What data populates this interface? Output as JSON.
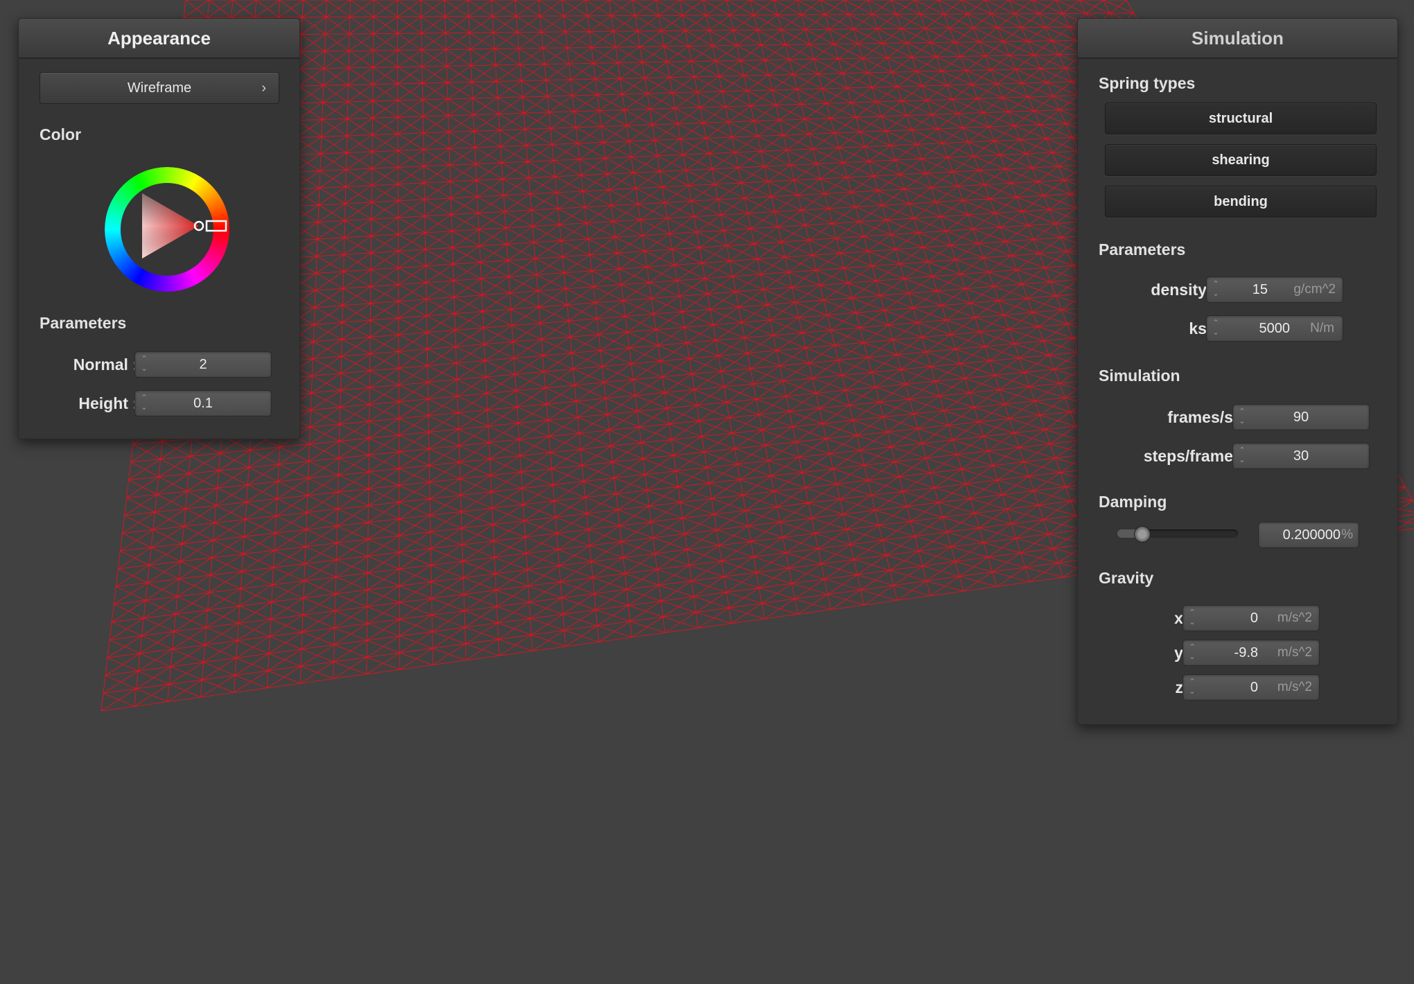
{
  "appearance": {
    "title": "Appearance",
    "shader_popup": {
      "label": "Wireframe",
      "chevron": "›"
    },
    "color": {
      "label": "Color",
      "value": "#d82020"
    },
    "parameters_label": "Parameters",
    "normal": {
      "label": "Normal :",
      "value": "2"
    },
    "height": {
      "label": "Height :",
      "value": "0.1"
    }
  },
  "simulation": {
    "title": "Simulation",
    "spring_types_label": "Spring types",
    "spring_types": [
      {
        "label": "structural"
      },
      {
        "label": "shearing"
      },
      {
        "label": "bending"
      }
    ],
    "parameters_label": "Parameters",
    "density": {
      "label": "density :",
      "value": "15",
      "unit": "g/cm^2"
    },
    "ks": {
      "label": "ks :",
      "value": "5000",
      "unit": "N/m"
    },
    "simulation_label": "Simulation",
    "frames_per_second": {
      "label": "frames/s :",
      "value": "90"
    },
    "steps_per_frame": {
      "label": "steps/frame :",
      "value": "30"
    },
    "damping_label": "Damping",
    "damping": {
      "slider_fraction": 0.2,
      "value": "0.200000",
      "unit": "%"
    },
    "gravity_label": "Gravity",
    "gravity": [
      {
        "label": "x :",
        "value": "0",
        "unit": "m/s^2"
      },
      {
        "label": "y :",
        "value": "-9.8",
        "unit": "m/s^2"
      },
      {
        "label": "z :",
        "value": "0",
        "unit": "m/s^2"
      }
    ]
  },
  "viewport": {
    "mesh_color": "#e0141e",
    "background": "#414141",
    "mesh_style": "wireframe"
  }
}
